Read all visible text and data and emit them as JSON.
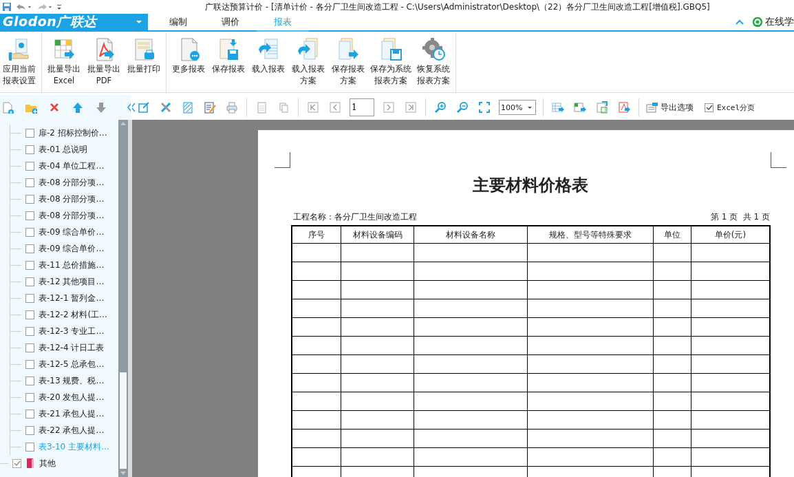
{
  "window": {
    "title": "广联达预算计价 - [清单计价 - 各分厂卫生间改造工程 - C:\\Users\\Administrator\\Desktop\\（22）各分厂卫生间改造工程[增值税].GBQ5]"
  },
  "menu": {
    "logo": "Glodon广联达",
    "tabs": [
      {
        "label": "编制",
        "selected": false
      },
      {
        "label": "调价",
        "selected": false
      },
      {
        "label": "报表",
        "selected": true
      }
    ],
    "online_help": "在线学"
  },
  "ribbon": {
    "groups": [
      [
        {
          "lines": [
            "应用当前",
            "报表设置"
          ]
        }
      ],
      [
        {
          "lines": [
            "批量导出",
            "Excel"
          ]
        },
        {
          "lines": [
            "批量导出",
            "PDF"
          ]
        },
        {
          "lines": [
            "批量打印"
          ]
        }
      ],
      [
        {
          "lines": [
            "更多报表"
          ]
        },
        {
          "lines": [
            "保存报表"
          ]
        },
        {
          "lines": [
            "载入报表"
          ]
        },
        {
          "lines": [
            "载入报表",
            "方案"
          ]
        },
        {
          "lines": [
            "保存报表",
            "方案"
          ]
        },
        {
          "lines": [
            "保存为系统",
            "报表方案"
          ]
        },
        {
          "lines": [
            "恢复系统",
            "报表方案"
          ]
        }
      ]
    ]
  },
  "toolbar": {
    "page_input": "1",
    "zoom": "100%",
    "export_options": "导出选项",
    "excel_paging": {
      "label": "Excel分页",
      "checked": true
    }
  },
  "tree": {
    "child_items": [
      {
        "label": "扉-2 招标控制价…",
        "checked": false,
        "selected": false
      },
      {
        "label": "表-01 总说明",
        "checked": false,
        "selected": false
      },
      {
        "label": "表-04 单位工程…",
        "checked": false,
        "selected": false
      },
      {
        "label": "表-08 分部分项…",
        "checked": false,
        "selected": false
      },
      {
        "label": "表-08 分部分项…",
        "checked": false,
        "selected": false
      },
      {
        "label": "表-08 分部分项…",
        "checked": false,
        "selected": false
      },
      {
        "label": "表-09 综合单价…",
        "checked": false,
        "selected": false
      },
      {
        "label": "表-09 综合单价…",
        "checked": false,
        "selected": false
      },
      {
        "label": "表-11 总价措施…",
        "checked": false,
        "selected": false
      },
      {
        "label": "表-12 其他项目…",
        "checked": false,
        "selected": false
      },
      {
        "label": "表-12-1 暂列金…",
        "checked": false,
        "selected": false
      },
      {
        "label": "表-12-2 材料(工…",
        "checked": false,
        "selected": false
      },
      {
        "label": "表-12-3 专业工…",
        "checked": false,
        "selected": false
      },
      {
        "label": "表-12-4 计日工表",
        "checked": false,
        "selected": false
      },
      {
        "label": "表-12-5 总承包…",
        "checked": false,
        "selected": false
      },
      {
        "label": "表-13 规费、税…",
        "checked": false,
        "selected": false
      },
      {
        "label": "表-20 发包人提…",
        "checked": false,
        "selected": false
      },
      {
        "label": "表-21 承包人提…",
        "checked": false,
        "selected": false
      },
      {
        "label": "表-22 承包人提…",
        "checked": false,
        "selected": false
      },
      {
        "label": "表3-10 主要材料…",
        "checked": false,
        "selected": true
      }
    ],
    "sibling_items": [
      {
        "label": "其他",
        "checked": true,
        "selected": false
      }
    ]
  },
  "report": {
    "title": "主要材料价格表",
    "project": "工程名称：各分厂卫生间改造工程",
    "page_info": "第 1 页  共 1 页",
    "columns": [
      "序号",
      "材料设备编码",
      "材料设备名称",
      "规格、型号等特殊要求",
      "单位",
      "单价(元)"
    ]
  }
}
